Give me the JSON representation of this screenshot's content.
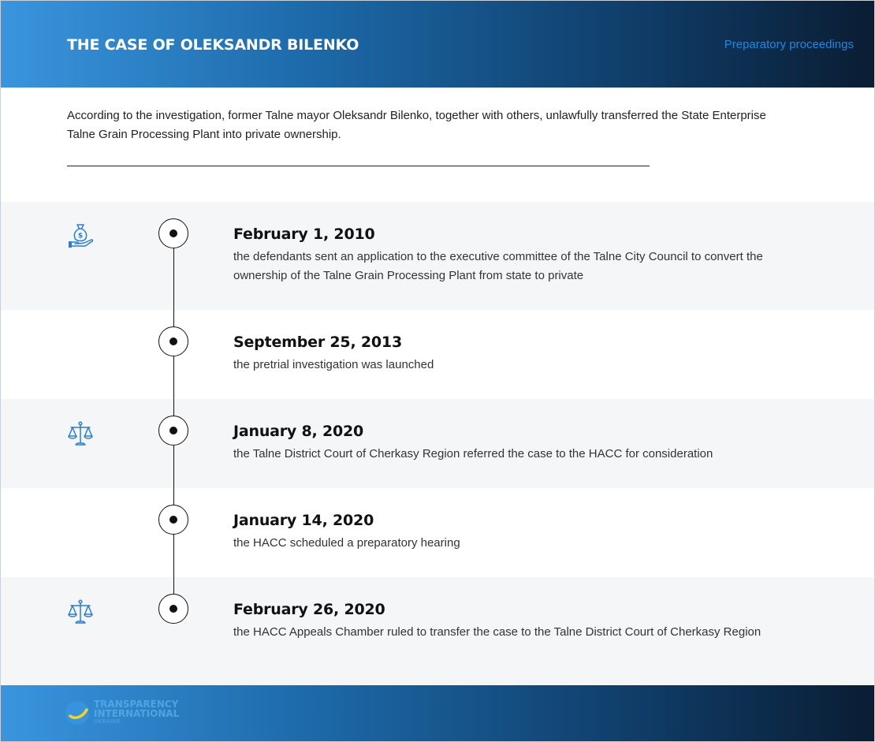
{
  "header": {
    "title": "THE CASE OF OLEKSANDR BILENKO",
    "stage": "Preparatory proceedings"
  },
  "intro": "According to the investigation, former Talne mayor Oleksandr Bilenko, together with others, unlawfully transferred the State Enterprise Talne Grain Processing Plant into private ownership.",
  "events": [
    {
      "date": "February 1, 2010",
      "text": "the defendants sent an application to the executive committee of the Talne City Council to convert the ownership of the Talne Grain Processing Plant from state to private",
      "icon": "money-bag-hand-icon"
    },
    {
      "date": "September 25, 2013",
      "text": "the pretrial investigation was launched",
      "icon": ""
    },
    {
      "date": "January 8, 2020",
      "text": "the Talne District Court of Cherkasy Region referred the case to the HACC for consideration",
      "icon": "scales-icon"
    },
    {
      "date": "January 14, 2020",
      "text": "the HACC scheduled a preparatory hearing",
      "icon": ""
    },
    {
      "date": "February 26, 2020",
      "text": "the HACC Appeals Chamber ruled to transfer the case to the Talne District Court of Cherkasy Region",
      "icon": "scales-icon"
    }
  ],
  "footer": {
    "logo_line1": "TRANSPARENCY",
    "logo_line2": "INTERNATIONAL",
    "logo_line3": "UKRAINE"
  },
  "colors": {
    "accent": "#1f88e0",
    "gradient_start": "#3a95de",
    "gradient_end": "#0a1d33",
    "row_shade": "#f5f6f8"
  }
}
